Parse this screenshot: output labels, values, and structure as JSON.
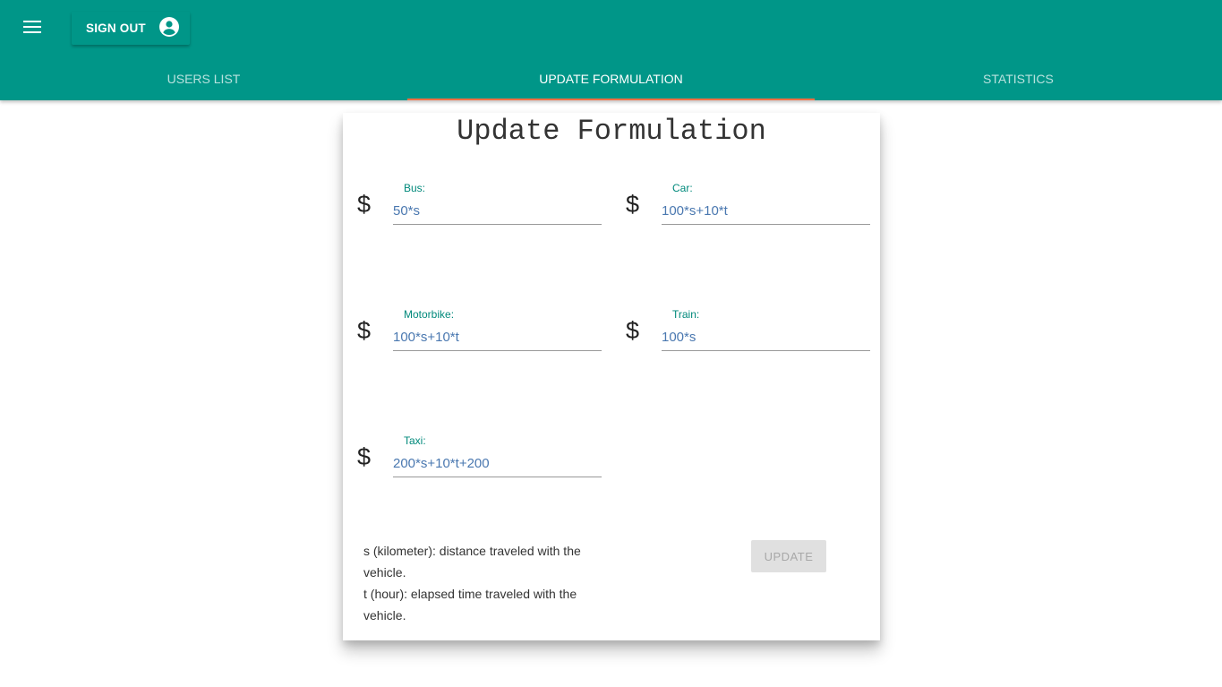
{
  "header": {
    "menu_icon": "menu-icon",
    "sign_out_label": "SIGN OUT",
    "account_icon": "account-circle-icon",
    "brand_color": "#009688",
    "tab_indicator_color": "#ff7043"
  },
  "tabs": [
    {
      "label": "USERS LIST",
      "active": false
    },
    {
      "label": "UPDATE FORMULATION",
      "active": true
    },
    {
      "label": "STATISTICS",
      "active": false
    }
  ],
  "form": {
    "title": "Update Formulation",
    "currency_symbol": "$",
    "fields": [
      {
        "label": "Bus:",
        "value": "50*s"
      },
      {
        "label": "Car:",
        "value": "100*s+10*t"
      },
      {
        "label": "Motorbike:",
        "value": "100*s+10*t"
      },
      {
        "label": "Train:",
        "value": "100*s"
      },
      {
        "label": "Taxi:",
        "value": "200*s+10*t+200"
      }
    ],
    "legend": [
      "s (kilometer): distance traveled with the vehicle.",
      "t (hour): elapsed time traveled with the vehicle."
    ],
    "update_label": "UPDATE",
    "update_disabled": true
  }
}
